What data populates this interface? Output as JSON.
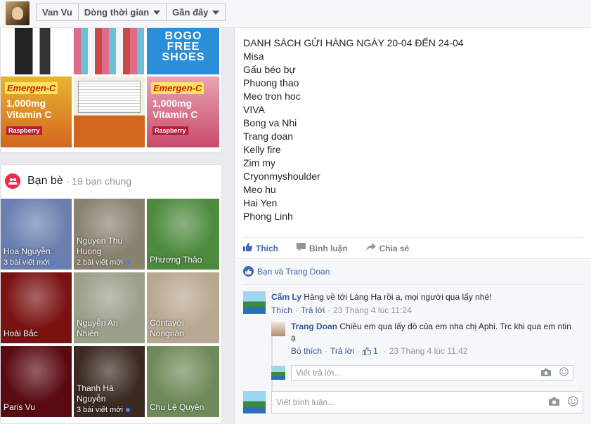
{
  "topbar": {
    "crumbs": [
      "Van Vu",
      "Dòng thời gian",
      "Gần đây"
    ]
  },
  "photos": {
    "bogo_text": "BOGO FREE SHOES",
    "emergen_label": "Emergen-C",
    "vitamin_text": "1,000mg Vitamin C",
    "raspberry_label": "Raspberry"
  },
  "friends": {
    "title": "Bạn bè",
    "subtitle": "· 19 bạn chung",
    "tiles": [
      {
        "name": "Hoa Nguyễn",
        "posts": "3 bài viết mới",
        "color": "#6a7fb0"
      },
      {
        "name": "Nguyen Thu Huong",
        "posts": "2 bài viết mới",
        "color": "#8a8270"
      },
      {
        "name": "Phương Thảo",
        "posts": "",
        "color": "#4e8a3e"
      },
      {
        "name": "Hoài Bắc",
        "posts": "",
        "color": "#7a1212"
      },
      {
        "name": "Nguyễn An Nhiên",
        "posts": "",
        "color": "#9aa08a"
      },
      {
        "name": "Côntavới Nồngnàn",
        "posts": "",
        "color": "#b8a891"
      },
      {
        "name": "Paris Vu",
        "posts": "",
        "color": "#5a0a12"
      },
      {
        "name": "Thanh Hà Nguyễn",
        "posts": "3 bài viết mới",
        "color": "#3a2a22"
      },
      {
        "name": "Chu Lệ Quyên",
        "posts": "",
        "color": "#6f8a5a"
      }
    ]
  },
  "post": {
    "lines": [
      "DANH SÁCH GỬI HÀNG NGÀY 20-04 ĐẾN 24-04",
      "Misa",
      "Gấu béo bự",
      "Phuong thao",
      "Meo tron hoc",
      "VIVA",
      "Bong va Nhi",
      "Trang doan",
      "Kelly fire",
      "Zim my",
      "Cryonmyshoulder",
      "Meo hu",
      "Hai Yen",
      "Phong Linh"
    ],
    "actions": {
      "like": "Thích",
      "comment": "Bình luận",
      "share": "Chia sẻ"
    }
  },
  "comments": {
    "likes_text": "Bạn và Trang Doan",
    "c1": {
      "author": "Cẩm Ly",
      "text": "Hàng về tới Láng Hạ rồi ạ, mọi người qua lấy nhé!",
      "like": "Thích",
      "reply": "Trả lời",
      "time": "23 Tháng 4 lúc 11:24"
    },
    "c2": {
      "author": "Trang Doan",
      "text": "Chiều em qua lấy đồ của em nha chị Aphi. Trc khi qua em ntin ạ",
      "unlike": "Bỏ thích",
      "reply": "Trả lời",
      "like_count": "1",
      "time": "23 Tháng 4 lúc 11:42"
    },
    "reply_placeholder": "Viết trả lời...",
    "comment_placeholder": "Viết bình luận..."
  }
}
